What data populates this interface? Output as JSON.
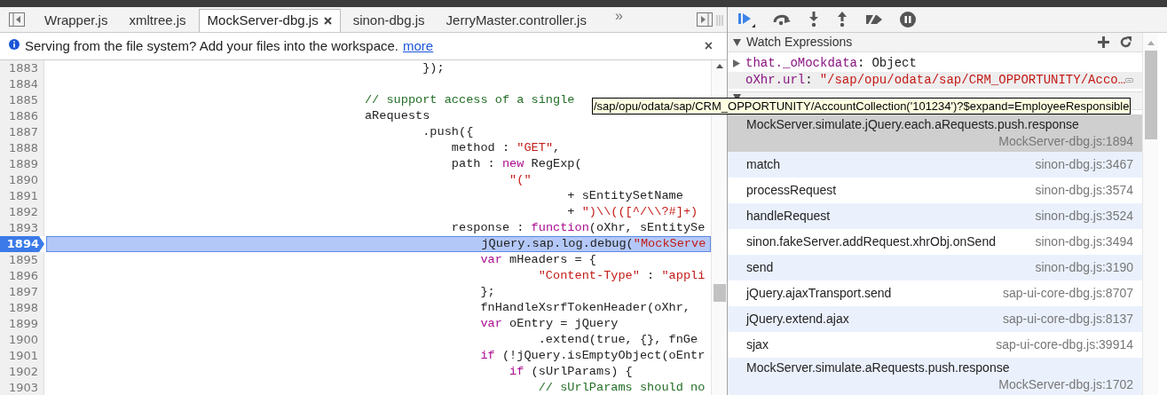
{
  "tabs": [
    {
      "label": "Wrapper.js",
      "selected": false,
      "closable": false
    },
    {
      "label": "xmltree.js",
      "selected": false,
      "closable": false
    },
    {
      "label": "MockServer-dbg.js",
      "selected": true,
      "closable": true
    },
    {
      "label": "sinon-dbg.js",
      "selected": false,
      "closable": false
    },
    {
      "label": "JerryMaster.controller.js",
      "selected": false,
      "closable": false
    }
  ],
  "tabs_overflow": "»",
  "infobar": {
    "text": "Serving from the file system? Add your files into the workspace.",
    "link": "more",
    "close": "×"
  },
  "code_lines": [
    {
      "number": "1883",
      "highlighted": false,
      "segments": [
        {
          "kind": "plain",
          "text": "                                                    });"
        }
      ]
    },
    {
      "number": "1884",
      "highlighted": false
    },
    {
      "number": "1885",
      "highlighted": false,
      "segments": [
        {
          "kind": "comment",
          "text": "                                            // support access of a single"
        }
      ]
    },
    {
      "number": "1886",
      "highlighted": false,
      "segments": [
        {
          "kind": "plain",
          "text": "                                            aRequests"
        }
      ]
    },
    {
      "number": "1887",
      "highlighted": false,
      "segments": [
        {
          "kind": "plain",
          "text": "                                                    .push({"
        }
      ]
    },
    {
      "number": "1888",
      "highlighted": false,
      "segments": [
        {
          "kind": "plain",
          "text": "                                                        method : "
        },
        {
          "kind": "string",
          "text": "\"GET\""
        },
        {
          "kind": "plain",
          "text": ","
        }
      ]
    },
    {
      "number": "1889",
      "highlighted": false,
      "segments": [
        {
          "kind": "plain",
          "text": "                                                        path : "
        },
        {
          "kind": "keyword",
          "text": "new"
        },
        {
          "kind": "plain",
          "text": " RegExp("
        }
      ]
    },
    {
      "number": "1890",
      "highlighted": false,
      "segments": [
        {
          "kind": "string",
          "text": "                                                                \"(\""
        }
      ]
    },
    {
      "number": "1891",
      "highlighted": false,
      "segments": [
        {
          "kind": "plain",
          "text": "                                                                        + sEntitySetName"
        }
      ]
    },
    {
      "number": "1892",
      "highlighted": false,
      "segments": [
        {
          "kind": "plain",
          "text": "                                                                        + "
        },
        {
          "kind": "string",
          "text": "\")\\\\(([^/\\\\?#]+)"
        }
      ]
    },
    {
      "number": "1893",
      "highlighted": false,
      "segments": [
        {
          "kind": "plain",
          "text": "                                                        response : "
        },
        {
          "kind": "keyword",
          "text": "function"
        },
        {
          "kind": "plain",
          "text": "(oXhr, sEntitySe"
        }
      ]
    },
    {
      "number": "1894",
      "highlighted": true,
      "segments": [
        {
          "kind": "plain",
          "text": "                                                            jQuery.sap.log.debug("
        },
        {
          "kind": "string",
          "text": "\"MockServe"
        }
      ]
    },
    {
      "number": "1895",
      "highlighted": false,
      "segments": [
        {
          "kind": "keyword",
          "text": "                                                            var"
        },
        {
          "kind": "plain",
          "text": " mHeaders = {"
        }
      ]
    },
    {
      "number": "1896",
      "highlighted": false,
      "segments": [
        {
          "kind": "string",
          "text": "                                                                    \"Content-Type\""
        },
        {
          "kind": "plain",
          "text": " : "
        },
        {
          "kind": "string",
          "text": "\"appli"
        }
      ]
    },
    {
      "number": "1897",
      "highlighted": false,
      "segments": [
        {
          "kind": "plain",
          "text": "                                                            };"
        }
      ]
    },
    {
      "number": "1898",
      "highlighted": false,
      "segments": [
        {
          "kind": "plain",
          "text": "                                                            fnHandleXsrfTokenHeader(oXhr,"
        }
      ]
    },
    {
      "number": "1899",
      "highlighted": false,
      "segments": [
        {
          "kind": "keyword",
          "text": "                                                            var"
        },
        {
          "kind": "plain",
          "text": " oEntry = jQuery"
        }
      ]
    },
    {
      "number": "1900",
      "highlighted": false,
      "segments": [
        {
          "kind": "plain",
          "text": "                                                                    .extend(true, {}, fnGe"
        }
      ]
    },
    {
      "number": "1901",
      "highlighted": false,
      "segments": [
        {
          "kind": "keyword",
          "text": "                                                            if"
        },
        {
          "kind": "plain",
          "text": " (!jQuery.isEmptyObject(oEntr"
        }
      ]
    },
    {
      "number": "1902",
      "highlighted": false,
      "segments": [
        {
          "kind": "keyword",
          "text": "                                                                if"
        },
        {
          "kind": "plain",
          "text": " (sUrlParams) {"
        }
      ]
    },
    {
      "number": "1903",
      "highlighted": false,
      "segments": [
        {
          "kind": "comment",
          "text": "                                                                    // sUrlParams should no"
        }
      ]
    }
  ],
  "watch": {
    "title": "Watch Expressions",
    "expanded": true,
    "separator": ":",
    "items": [
      {
        "name": "that._oMockdata",
        "value": "Object",
        "kind": "object",
        "hovered": false
      },
      {
        "name": "oXhr.url",
        "value": "\"/sap/opu/odata/sap/CRM_OPPORTUNITY/Acco…",
        "kind": "string",
        "hovered": true
      }
    ]
  },
  "call_stack": {
    "expanded": true,
    "frames": [
      {
        "function": "MockServer.simulate.jQuery.each.aRequests.push.response",
        "location": "MockServer-dbg.js:1894",
        "selected": true
      },
      {
        "function": "match",
        "location": "sinon-dbg.js:3467",
        "selected": false
      },
      {
        "function": "processRequest",
        "location": "sinon-dbg.js:3574",
        "selected": false
      },
      {
        "function": "handleRequest",
        "location": "sinon-dbg.js:3524",
        "selected": false
      },
      {
        "function": "sinon.fakeServer.addRequest.xhrObj.onSend",
        "location": "sinon-dbg.js:3494",
        "selected": false
      },
      {
        "function": "send",
        "location": "sinon-dbg.js:3190",
        "selected": false
      },
      {
        "function": "jQuery.ajaxTransport.send",
        "location": "sap-ui-core-dbg.js:8707",
        "selected": false
      },
      {
        "function": "jQuery.extend.ajax",
        "location": "sap-ui-core-dbg.js:8137",
        "selected": false
      },
      {
        "function": "sjax",
        "location": "sap-ui-core-dbg.js:39914",
        "selected": false
      },
      {
        "function": "MockServer.simulate.aRequests.push.response",
        "location": "MockServer-dbg.js:1702",
        "selected": false
      }
    ]
  },
  "tooltip": "/sap/opu/odata/sap/CRM_OPPORTUNITY/AccountCollection('101234')?$expand=EmployeeResponsible"
}
